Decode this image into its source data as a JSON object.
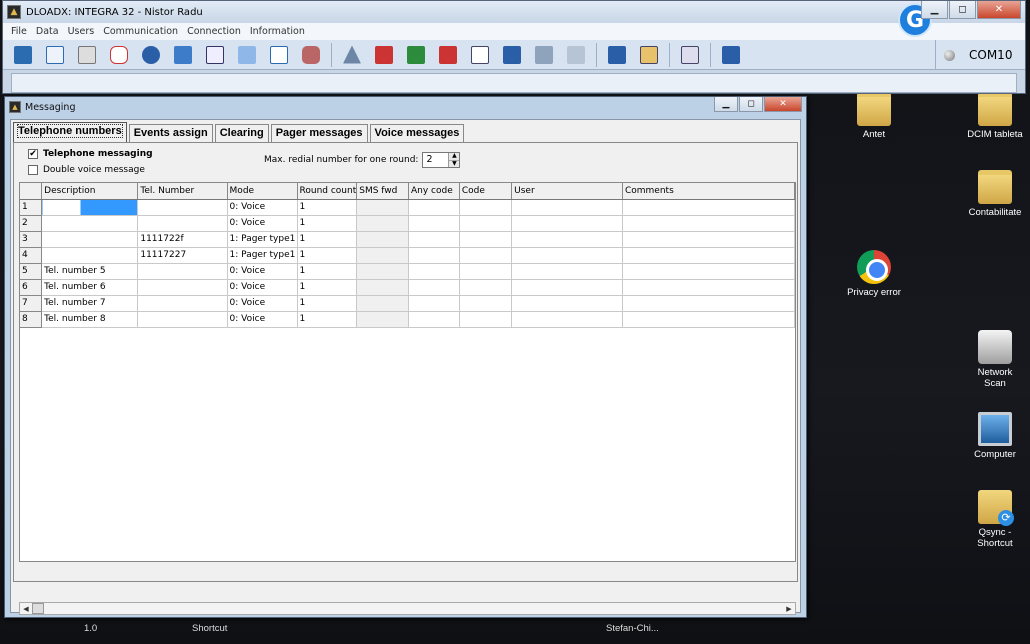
{
  "main_window": {
    "title": "DLOADX: INTEGRA 32 - Nistor Radu",
    "menu": [
      "File",
      "Data",
      "Users",
      "Communication",
      "Connection",
      "Information"
    ],
    "toolbar_icons": [
      "structure-icon",
      "checklist-icon",
      "module-icon",
      "detector-icon",
      "clock-icon",
      "monitor-eye-icon",
      "phone-icon",
      "keypad-icon",
      "settings-doc-icon",
      "users-icon",
      "triangle-icon",
      "help-icon",
      "connect-icon",
      "disconnect-icon",
      "document-icon",
      "read-icon",
      "stop-icon",
      "write-icon",
      "calculator-icon",
      "picture-icon",
      "key-icon",
      "screen-icon"
    ],
    "com_port": "COM10",
    "controls": {
      "minimize": "▁",
      "maximize": "◻",
      "close": "✕"
    }
  },
  "messaging_window": {
    "title": "Messaging",
    "tabs": [
      "Telephone numbers",
      "Events assign",
      "Clearing",
      "Pager messages",
      "Voice messages"
    ],
    "telephone_messaging": {
      "label": "Telephone messaging",
      "checked": true
    },
    "double_voice": {
      "label": "Double voice message",
      "checked": false
    },
    "max_redial": {
      "label": "Max. redial number for one round:",
      "value": "2"
    },
    "columns": [
      "Description",
      "Tel. Number",
      "Mode",
      "Round count",
      "SMS fwd",
      "Any code",
      "Code",
      "User",
      "Comments"
    ],
    "rows": [
      {
        "num": "1",
        "description": "",
        "tel": "",
        "mode": "0: Voice",
        "round": "1"
      },
      {
        "num": "2",
        "description": "",
        "tel": "",
        "mode": "0: Voice",
        "round": "1"
      },
      {
        "num": "3",
        "description": "",
        "tel": "1111722f",
        "mode": "1: Pager type1",
        "round": "1"
      },
      {
        "num": "4",
        "description": "",
        "tel": "11117227",
        "mode": "1: Pager type1",
        "round": "1"
      },
      {
        "num": "5",
        "description": "Tel. number  5",
        "tel": "",
        "mode": "0: Voice",
        "round": "1"
      },
      {
        "num": "6",
        "description": "Tel. number  6",
        "tel": "",
        "mode": "0: Voice",
        "round": "1"
      },
      {
        "num": "7",
        "description": "Tel. number  7",
        "tel": "",
        "mode": "0: Voice",
        "round": "1"
      },
      {
        "num": "8",
        "description": "Tel. number  8",
        "tel": "",
        "mode": "0: Voice",
        "round": "1"
      }
    ]
  },
  "desktop_icons": [
    {
      "label": "Antet",
      "icon": "folder-icon"
    },
    {
      "label": "DCIM tableta",
      "icon": "folder-icon"
    },
    {
      "label": "Contabilitate",
      "icon": "folder-icon"
    },
    {
      "label": "Privacy error",
      "icon": "chrome-icon"
    },
    {
      "label": "Network Scan",
      "icon": "scanner-icon"
    },
    {
      "label": "Computer",
      "icon": "computer-icon"
    },
    {
      "label": "Qsync - Shortcut",
      "icon": "qsync-icon"
    }
  ],
  "taskbar_labels": [
    "1.0",
    "Shortcut",
    "Stefan-Chi..."
  ]
}
